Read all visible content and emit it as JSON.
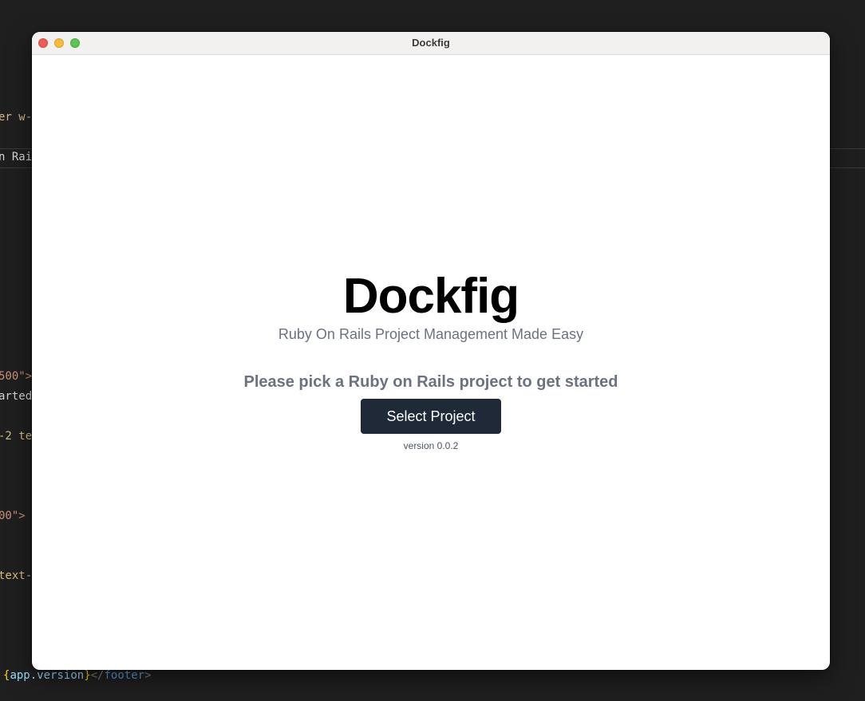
{
  "background_editor": {
    "line1": "er w-",
    "line2": "n Rai",
    "line3": "500\">",
    "line4": "arted",
    "line5": "-2 te",
    "line6": "00\">",
    "line7": "text-",
    "footer_open": "{",
    "footer_var_obj": "app",
    "footer_dot": ".",
    "footer_var_prop": "version",
    "footer_close": "}",
    "footer_tag_open": "</",
    "footer_tag": "footer",
    "footer_tag_close": ">"
  },
  "window": {
    "title": "Dockfig"
  },
  "main": {
    "title": "Dockfig",
    "subtitle": "Ruby On Rails Project Management Made Easy",
    "prompt": "Please pick a Ruby on Rails project to get started",
    "select_button_label": "Select Project",
    "version_text": "version 0.0.2"
  },
  "colors": {
    "button_bg": "#1f2937",
    "muted_text": "#6b7280",
    "close": "#ec5f58",
    "minimize": "#f4bd3f",
    "maximize": "#5fc454"
  }
}
